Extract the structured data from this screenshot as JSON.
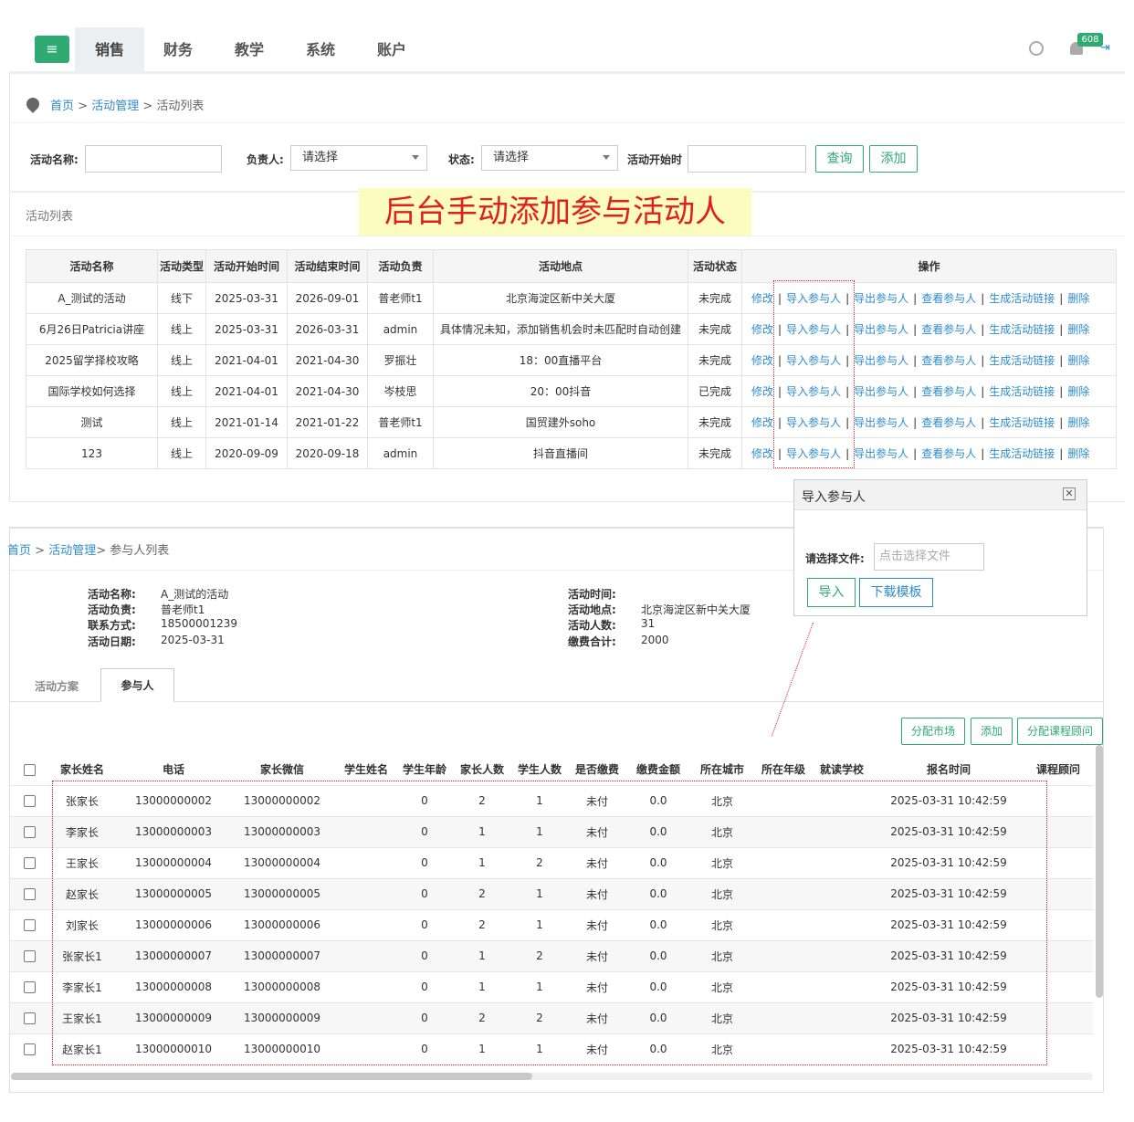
{
  "nav": {
    "tabs": [
      "销售",
      "财务",
      "教学",
      "系统",
      "账户"
    ],
    "badge": "608"
  },
  "breadcrumb1": {
    "home": "首页",
    "mgmt": "活动管理",
    "current": "活动列表"
  },
  "filters": {
    "name_label": "活动名称:",
    "owner_label": "负责人:",
    "owner_value": "请选择",
    "status_label": "状态:",
    "status_value": "请选择",
    "start_label": "活动开始时",
    "query": "查询",
    "add": "添加"
  },
  "list_title": "活动列表",
  "banner": "后台手动添加参与活动人",
  "activity_table": {
    "headers": [
      "活动名称",
      "活动类型",
      "活动开始时间",
      "活动结束时间",
      "活动负责",
      "活动地点",
      "活动状态",
      "操作"
    ],
    "ops": [
      "修改",
      "导入参与人",
      "导出参与人",
      "查看参与人",
      "生成活动链接",
      "删除"
    ],
    "rows": [
      [
        "A_测试的活动",
        "线下",
        "2025-03-31",
        "2026-09-01",
        "普老师t1",
        "北京海淀区新中关大厦",
        "未完成"
      ],
      [
        "6月26日Patricia讲座",
        "线上",
        "2025-03-31",
        "2026-03-31",
        "admin",
        "具体情况未知，添加销售机会时未匹配时自动创建",
        "未完成"
      ],
      [
        "2025留学择校攻略",
        "线上",
        "2021-04-01",
        "2021-04-30",
        "罗振壮",
        "18：00直播平台",
        "未完成"
      ],
      [
        "国际学校如何选择",
        "线上",
        "2021-04-01",
        "2021-04-30",
        "岑枝思",
        "20：00抖音",
        "已完成"
      ],
      [
        "测试",
        "线上",
        "2021-01-14",
        "2021-01-22",
        "普老师t1",
        "国贸建外soho",
        "未完成"
      ],
      [
        "123",
        "线上",
        "2020-09-09",
        "2020-09-18",
        "admin",
        "抖音直播间",
        "未完成"
      ]
    ]
  },
  "dialog": {
    "title": "导入参与人",
    "close": "✕",
    "file_label": "请选择文件:",
    "file_placeholder": "点击选择文件",
    "import": "导入",
    "download": "下载模板"
  },
  "breadcrumb2": {
    "home": "首页",
    "mgmt": "活动管理",
    "current": "> 参与人列表"
  },
  "info": {
    "name_k": "活动名称:",
    "name_v": "A_测试的活动",
    "owner_k": "活动负责:",
    "owner_v": "普老师t1",
    "contact_k": "联系方式:",
    "contact_v": "18500001239",
    "date_k": "活动日期:",
    "date_v": "2025-03-31",
    "time_k": "活动时间:",
    "time_v": "",
    "place_k": "活动地点:",
    "place_v": "北京海淀区新中关大厦",
    "count_k": "活动人数:",
    "count_v": "31",
    "fee_k": "缴费合计:",
    "fee_v": "2000"
  },
  "tabs2": {
    "plan": "活动方案",
    "people": "参与人"
  },
  "actions": {
    "assign_market": "分配市场",
    "add": "添加",
    "assign_advisor": "分配课程顾问"
  },
  "people_table": {
    "headers": [
      "家长姓名",
      "电话",
      "家长微信",
      "学生姓名",
      "学生年龄",
      "家长人数",
      "学生人数",
      "是否缴费",
      "缴费金额",
      "所在城市",
      "所在年级",
      "就读学校",
      "报名时间",
      "课程顾问"
    ],
    "rows": [
      [
        "张家长",
        "13000000002",
        "13000000002",
        "",
        "0",
        "2",
        "1",
        "未付",
        "0.0",
        "北京",
        "",
        "",
        "2025-03-31 10:42:59"
      ],
      [
        "李家长",
        "13000000003",
        "13000000003",
        "",
        "0",
        "1",
        "1",
        "未付",
        "0.0",
        "北京",
        "",
        "",
        "2025-03-31 10:42:59"
      ],
      [
        "王家长",
        "13000000004",
        "13000000004",
        "",
        "0",
        "1",
        "2",
        "未付",
        "0.0",
        "北京",
        "",
        "",
        "2025-03-31 10:42:59"
      ],
      [
        "赵家长",
        "13000000005",
        "13000000005",
        "",
        "0",
        "2",
        "1",
        "未付",
        "0.0",
        "北京",
        "",
        "",
        "2025-03-31 10:42:59"
      ],
      [
        "刘家长",
        "13000000006",
        "13000000006",
        "",
        "0",
        "2",
        "1",
        "未付",
        "0.0",
        "北京",
        "",
        "",
        "2025-03-31 10:42:59"
      ],
      [
        "张家长1",
        "13000000007",
        "13000000007",
        "",
        "0",
        "1",
        "2",
        "未付",
        "0.0",
        "北京",
        "",
        "",
        "2025-03-31 10:42:59"
      ],
      [
        "李家长1",
        "13000000008",
        "13000000008",
        "",
        "0",
        "1",
        "1",
        "未付",
        "0.0",
        "北京",
        "",
        "",
        "2025-03-31 10:42:59"
      ],
      [
        "王家长1",
        "13000000009",
        "13000000009",
        "",
        "0",
        "2",
        "2",
        "未付",
        "0.0",
        "北京",
        "",
        "",
        "2025-03-31 10:42:59"
      ],
      [
        "赵家长1",
        "13000000010",
        "13000000010",
        "",
        "0",
        "1",
        "1",
        "未付",
        "0.0",
        "北京",
        "",
        "",
        "2025-03-31 10:42:59"
      ]
    ]
  }
}
